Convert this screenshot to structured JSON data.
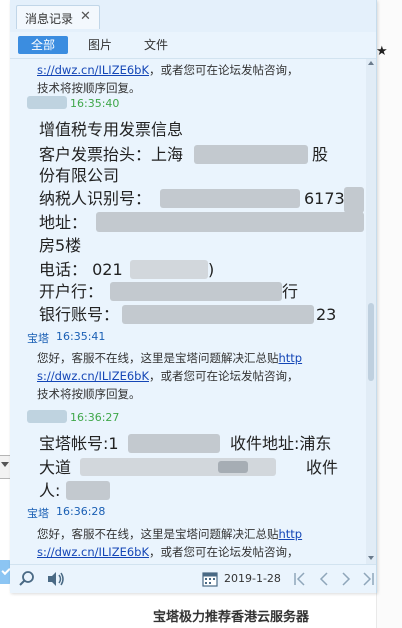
{
  "window": {
    "tab_title": "消息记录",
    "tab_close": "✕"
  },
  "filters": [
    "全部",
    "图片",
    "文件"
  ],
  "messages": {
    "m1_line1_link": "s://dwz.cn/ILIZE6bK",
    "m1_line1_rest": "，或者您可在论坛发帖咨询，",
    "m1_line2": "技术将按顺序回复。",
    "m2_time": "16:35:40",
    "m2_lines": [
      "增值税专用发票信息",
      "客户发票抬头：上海",
      "股",
      "份有限公司",
      "纳税人识别号：",
      "6173",
      "地址：",
      "房5楼",
      "电话：  021",
      ")",
      "开户行：",
      "行",
      "银行账号：",
      "23"
    ],
    "m3_sender": "宝塔",
    "m3_time": "16:35:41",
    "m3_text_a": "您好，客服不在线，这里是宝塔问题解决汇总贴",
    "m3_link_a": "http",
    "m3_link_b": "s://dwz.cn/ILIZE6bK",
    "m3_text_b": "，或者您可在论坛发帖咨询，",
    "m3_text_c": "技术将按顺序回复。",
    "m4_time": "16:36:27",
    "m4_line1_a": "宝塔帐号:1",
    "m4_line1_b": "收件地址:浦东",
    "m4_line2_a": "大道",
    "m4_line2_b": "收件",
    "m4_line3": "人:",
    "m5_sender": "宝塔",
    "m5_time": "16:36:28",
    "m5_text_a": "您好，客服不在线，这里是宝塔问题解决汇总贴",
    "m5_link_a": "http",
    "m5_link_b": "s://dwz.cn/ILIZE6bK",
    "m5_text_b": "，或者您可在论坛发帖咨询，"
  },
  "bottom": {
    "date": "2019-1-28"
  },
  "background": {
    "star": "★",
    "footer_text": "宝塔极力推荐香港云服务器"
  },
  "icons": {
    "search": "search-icon",
    "sound": "speaker-icon",
    "calendar": "calendar-icon",
    "first": "first-page-icon",
    "prev": "prev-page-icon",
    "next": "next-page-icon",
    "last": "last-page-icon"
  },
  "colors": {
    "accent": "#3b8de0",
    "link": "#1446b6",
    "sender_time": "#1a5fb4",
    "self_time": "#3fa74a",
    "window_bg": "#eaf4fd"
  }
}
